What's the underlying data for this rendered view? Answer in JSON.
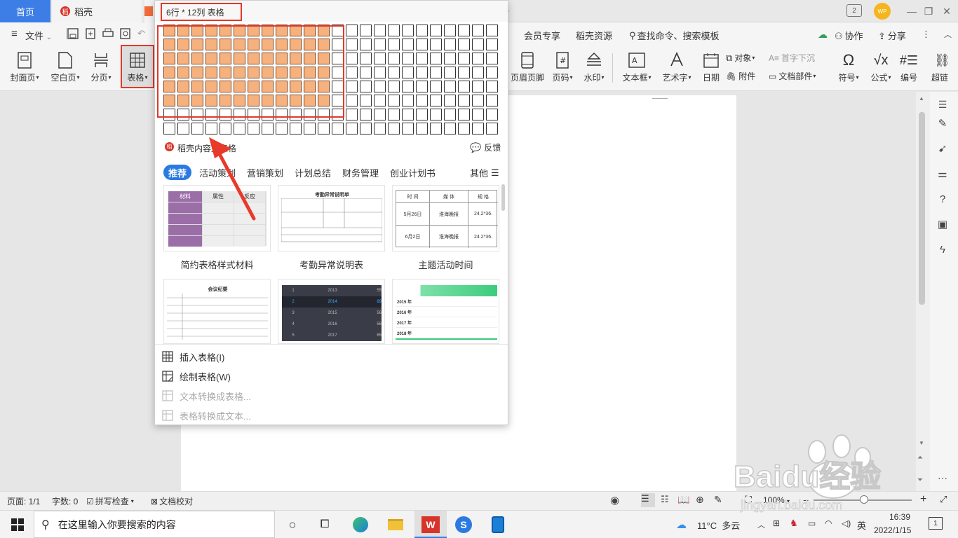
{
  "titlebar": {
    "tabs": [
      {
        "label": "首页"
      },
      {
        "label": "稻壳"
      },
      {
        "label": ""
      }
    ],
    "badge_count": "2",
    "avatar_text": "WP"
  },
  "menu": {
    "file_label": "文件",
    "items": [
      "会员专享",
      "稻壳资源"
    ],
    "search_placeholder": "查找命令、搜索模板",
    "collab_label": "协作",
    "share_label": "分享"
  },
  "ribbon": {
    "left": [
      {
        "label": "封面页"
      },
      {
        "label": "空白页"
      },
      {
        "label": "分页"
      },
      {
        "label": "表格"
      }
    ],
    "right": [
      {
        "label": "页眉页脚"
      },
      {
        "label": "页码"
      },
      {
        "label": "水印"
      },
      {
        "label": "文本框"
      },
      {
        "label": "艺术字"
      },
      {
        "label": "日期"
      },
      {
        "label": "符号"
      },
      {
        "label": "公式"
      },
      {
        "label": "编号"
      },
      {
        "label": "超链"
      }
    ],
    "small": {
      "object": "对象",
      "dropcap": "首字下沉",
      "attach": "附件",
      "docpart": "文档部件"
    }
  },
  "dropdown": {
    "title": "6行 * 12列 表格",
    "grid": {
      "rows": 8,
      "cols": 24,
      "selected_rows": 6,
      "selected_cols": 12
    },
    "docer_label": "稻壳内容型表格",
    "feedback_label": "反馈",
    "categories": [
      "推荐",
      "活动策划",
      "营销策划",
      "计划总结",
      "财务管理",
      "创业计划书"
    ],
    "more_label": "其他",
    "templates": [
      {
        "name": "简约表格样式材料"
      },
      {
        "name": "考勤异常说明表"
      },
      {
        "name": "主题活动时间"
      }
    ],
    "tpl_thumbs": {
      "t1_headers": [
        "材料",
        "属性",
        "反应"
      ],
      "t2_title": "考勤异常说明单",
      "t3_headers": [
        "时 间",
        "媒 体",
        "规 格"
      ],
      "t3_rows": [
        [
          "5月26日",
          "淮海晚报",
          "24.2*36."
        ],
        [
          "6月2日",
          "淮海晚报",
          "24.2*36."
        ]
      ],
      "t4_title": "会议纪要",
      "t5_rows": [
        [
          "1",
          "2013",
          "55"
        ],
        [
          "2",
          "2014",
          "89"
        ],
        [
          "3",
          "2015",
          "56"
        ],
        [
          "4",
          "2016",
          "56"
        ],
        [
          "5",
          "2017",
          "65"
        ]
      ],
      "t6_rows": [
        "2015 年",
        "2016 年",
        "2017 年",
        "2018 年"
      ]
    },
    "actions": [
      {
        "label": "插入表格(I)",
        "enabled": true
      },
      {
        "label": "绘制表格(W)",
        "enabled": true
      },
      {
        "label": "文本转换成表格...",
        "enabled": false
      },
      {
        "label": "表格转换成文本...",
        "enabled": false
      }
    ]
  },
  "statusbar": {
    "page": "页面: 1/1",
    "words": "字数: 0",
    "spellcheck": "拼写检查",
    "proofread": "文档校对",
    "zoom": "100%"
  },
  "taskbar": {
    "search_placeholder": "在这里输入你要搜索的内容",
    "weather": "11°C  多云",
    "ime": "英",
    "time": "16:39",
    "date": "2022/1/15",
    "notifications": "1"
  },
  "watermark": {
    "brand": "Baidu经验",
    "url": "jingyan.baidu.com"
  },
  "colors": {
    "accent": "#3c7de6",
    "highlight": "#e03a2a",
    "cell_selected": "#f7b17d"
  }
}
